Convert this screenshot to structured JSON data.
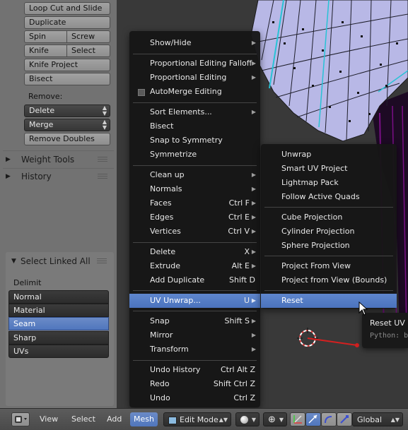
{
  "toolshelf": {
    "buttons": {
      "loop_cut": "Loop Cut and Slide",
      "duplicate": "Duplicate",
      "spin": "Spin",
      "screw": "Screw",
      "knife": "Knife",
      "select": "Select",
      "knife_project": "Knife Project",
      "bisect": "Bisect",
      "remove_doubles": "Remove Doubles"
    },
    "remove_label": "Remove:",
    "delete_dropdown": "Delete",
    "merge_dropdown": "Merge",
    "panels": {
      "weight_tools": "Weight Tools",
      "history": "History"
    }
  },
  "redo_panel": {
    "title": "Select Linked All",
    "delimit_label": "Delimit",
    "options": [
      "Normal",
      "Material",
      "Seam",
      "Sharp",
      "UVs"
    ],
    "selected": "Seam"
  },
  "mesh_menu": {
    "items": [
      {
        "label": "Show/Hide",
        "shortcut": "",
        "submenu": true
      },
      {
        "label": "Proportional Editing Falloff",
        "shortcut": "",
        "submenu": true
      },
      {
        "label": "Proportional Editing",
        "shortcut": "",
        "submenu": true
      },
      {
        "label": "AutoMerge Editing",
        "shortcut": "",
        "submenu": false
      },
      {
        "label": "Sort Elements...",
        "shortcut": "",
        "submenu": true
      },
      {
        "label": "Bisect",
        "shortcut": "",
        "submenu": false
      },
      {
        "label": "Snap to Symmetry",
        "shortcut": "",
        "submenu": false
      },
      {
        "label": "Symmetrize",
        "shortcut": "",
        "submenu": false
      },
      {
        "label": "Clean up",
        "shortcut": "",
        "submenu": true
      },
      {
        "label": "Normals",
        "shortcut": "",
        "submenu": true
      },
      {
        "label": "Faces",
        "shortcut": "Ctrl F",
        "submenu": true
      },
      {
        "label": "Edges",
        "shortcut": "Ctrl E",
        "submenu": true
      },
      {
        "label": "Vertices",
        "shortcut": "Ctrl V",
        "submenu": true
      },
      {
        "label": "Delete",
        "shortcut": "X",
        "submenu": true
      },
      {
        "label": "Extrude",
        "shortcut": "Alt E",
        "submenu": true
      },
      {
        "label": "Add Duplicate",
        "shortcut": "Shift D",
        "submenu": false
      },
      {
        "label": "UV Unwrap...",
        "shortcut": "U",
        "submenu": true
      },
      {
        "label": "Snap",
        "shortcut": "Shift S",
        "submenu": true
      },
      {
        "label": "Mirror",
        "shortcut": "",
        "submenu": true
      },
      {
        "label": "Transform",
        "shortcut": "",
        "submenu": true
      },
      {
        "label": "Undo History",
        "shortcut": "Ctrl Alt Z",
        "submenu": false
      },
      {
        "label": "Redo",
        "shortcut": "Shift Ctrl Z",
        "submenu": false
      },
      {
        "label": "Undo",
        "shortcut": "Ctrl Z",
        "submenu": false
      }
    ],
    "highlighted": "UV Unwrap..."
  },
  "uv_menu": {
    "items": [
      "Unwrap",
      "Smart UV Project",
      "Lightmap Pack",
      "Follow Active Quads",
      "Cube Projection",
      "Cylinder Projection",
      "Sphere Projection",
      "Project From View",
      "Project from View (Bounds)",
      "Reset"
    ],
    "highlighted": "Reset"
  },
  "tooltip": {
    "title": "Reset UV p",
    "python": "Python: b"
  },
  "header": {
    "view": "View",
    "select": "Select",
    "add": "Add",
    "mesh": "Mesh",
    "mode": "Edit Mode",
    "orientation": "Global"
  },
  "colors": {
    "menu_bg": "#161616",
    "highlight": "#5680c2",
    "mesh_face": "#b9b9e6",
    "mesh_edge": "#1a1a1a",
    "mesh_seam": "#27c3d6",
    "mesh_magenta": "#7a0f86"
  },
  "icons": [
    "editor-type-icon",
    "shading-solid-icon",
    "pivot-icon",
    "manipulator-icon",
    "translate-icon",
    "rotate-icon",
    "scale-icon",
    "checkbox-icon",
    "chevron-right-icon",
    "cursor-arrow-icon",
    "3d-cursor-icon"
  ]
}
